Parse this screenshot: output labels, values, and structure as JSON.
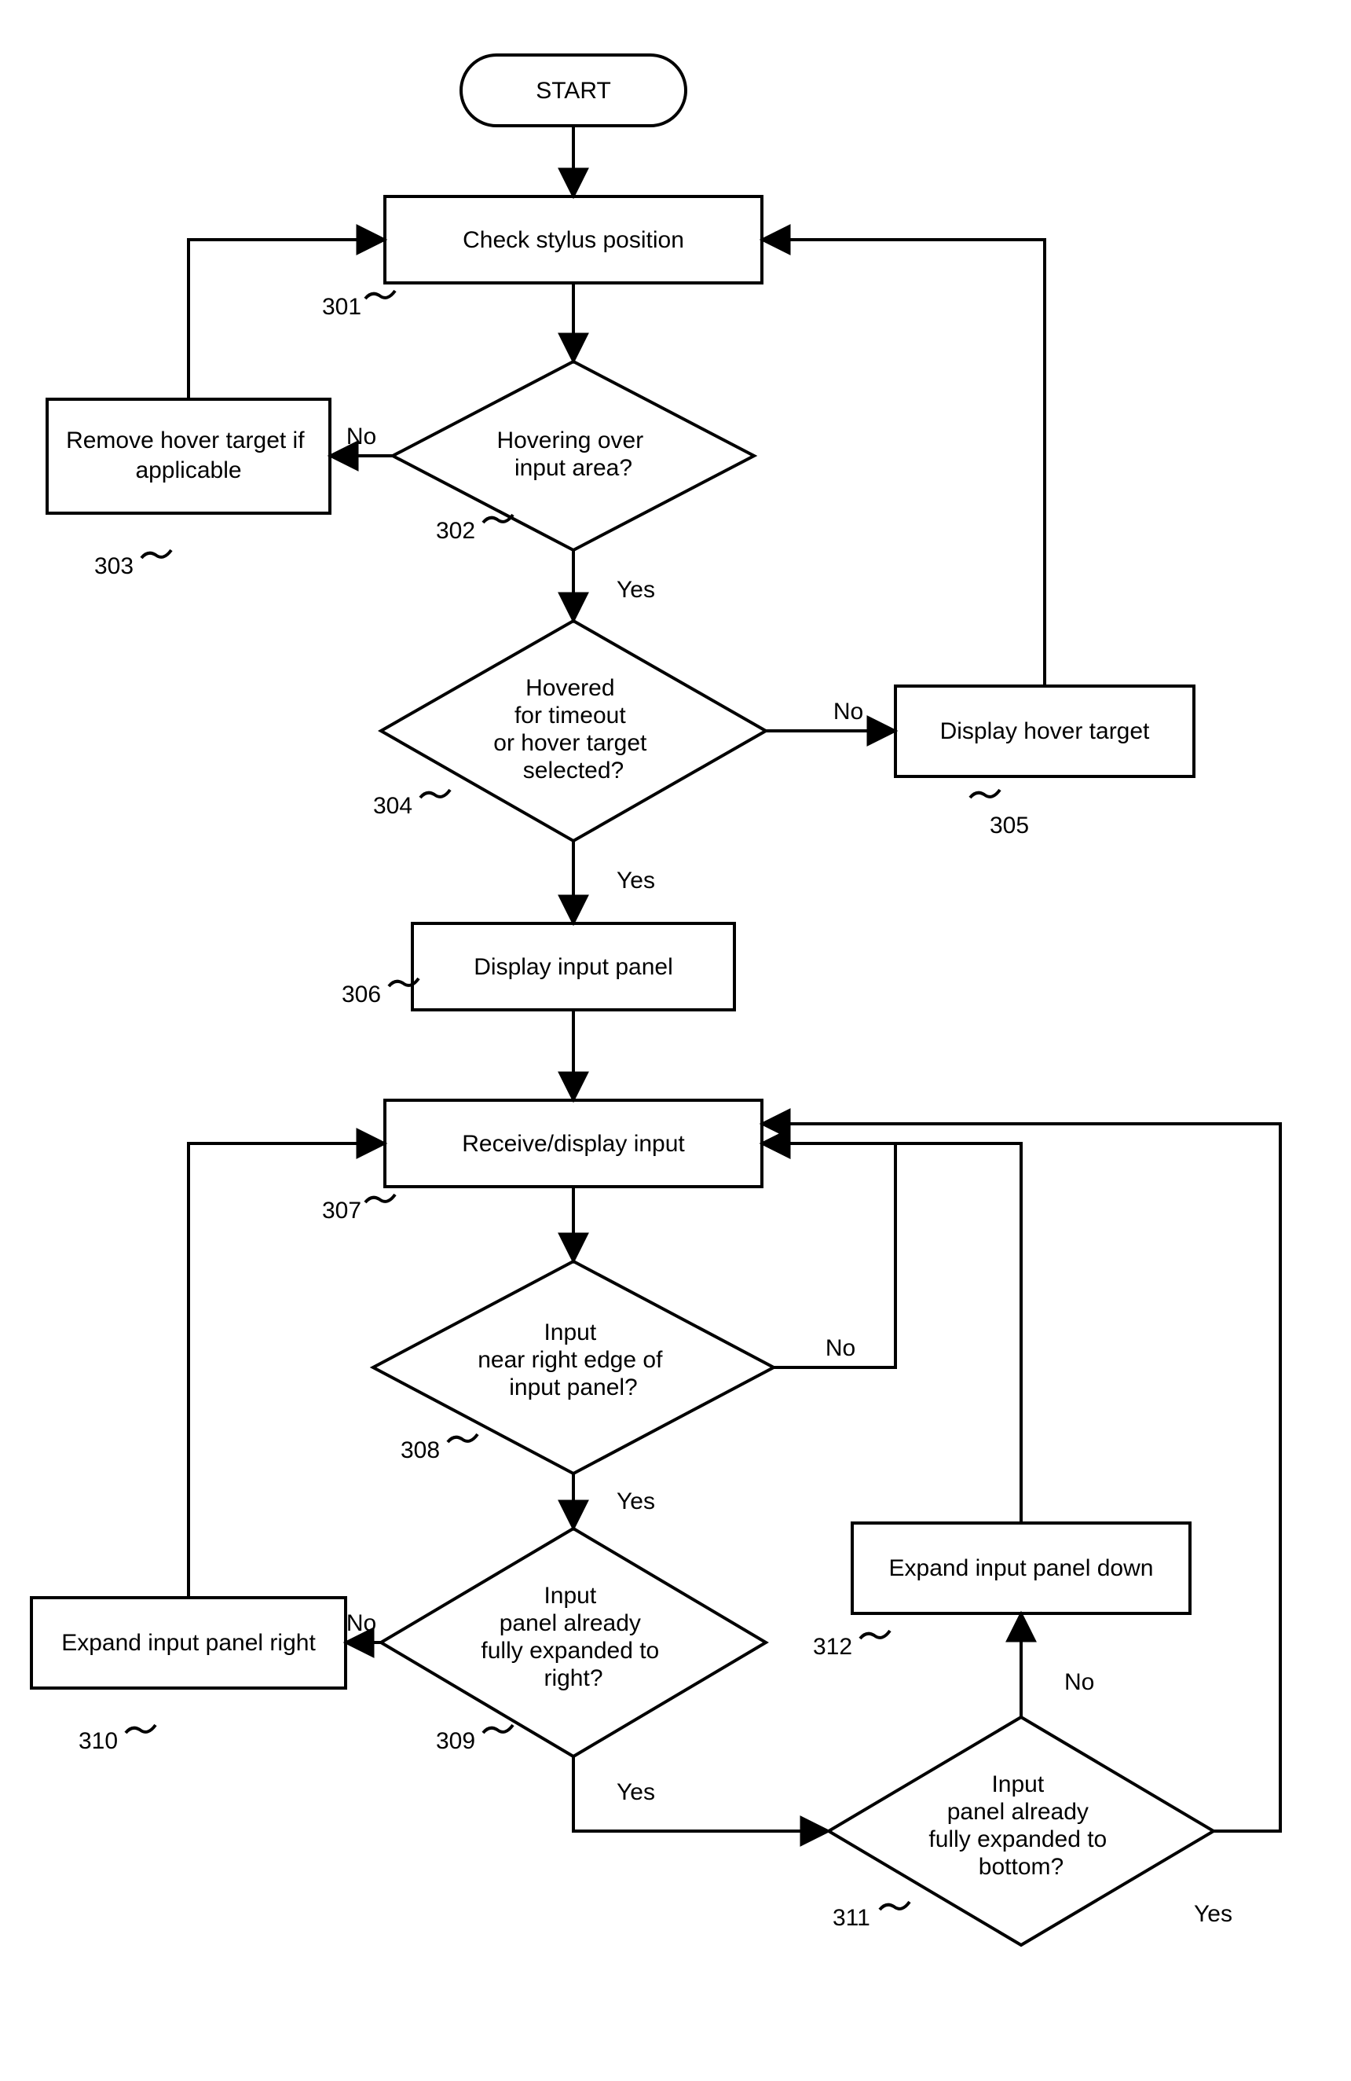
{
  "start": "START",
  "nodes": {
    "301": "Check stylus position",
    "302": [
      "Hovering over",
      "input area?"
    ],
    "303": [
      "Remove hover target if",
      "applicable"
    ],
    "304": [
      "Hovered",
      "for timeout",
      "or hover target",
      "selected?"
    ],
    "305": "Display hover target",
    "306": "Display input panel",
    "307": "Receive/display input",
    "308": [
      "Input",
      "near right edge of",
      "input panel?"
    ],
    "309": [
      "Input",
      "panel already",
      "fully expanded to",
      "right?"
    ],
    "310": "Expand input panel right",
    "311": [
      "Input",
      "panel already",
      "fully expanded to",
      "bottom?"
    ],
    "312": "Expand input panel down"
  },
  "edge_labels": {
    "yes": "Yes",
    "no": "No"
  },
  "refs": {
    "301": "301",
    "302": "302",
    "303": "303",
    "304": "304",
    "305": "305",
    "306": "306",
    "307": "307",
    "308": "308",
    "309": "309",
    "310": "310",
    "311": "311",
    "312": "312"
  }
}
